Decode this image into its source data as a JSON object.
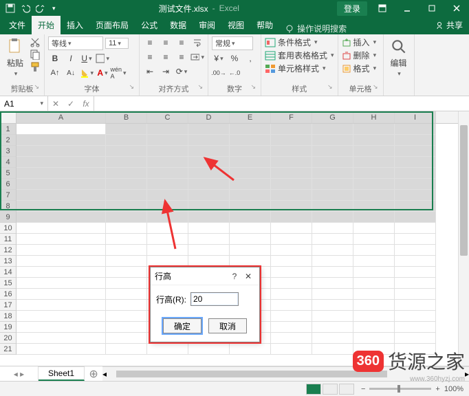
{
  "titlebar": {
    "filename": "测试文件.xlsx",
    "app": "Excel",
    "login": "登录"
  },
  "tabs": {
    "file": "文件",
    "home": "开始",
    "insert": "插入",
    "layout": "页面布局",
    "formulas": "公式",
    "data": "数据",
    "review": "审阅",
    "view": "视图",
    "help": "帮助",
    "tellme": "操作说明搜索",
    "share": "共享"
  },
  "ribbon": {
    "clipboard": {
      "paste": "粘贴",
      "label": "剪贴板"
    },
    "font": {
      "name": "等线",
      "size": "11",
      "label": "字体",
      "bold": "B",
      "italic": "I",
      "underline": "U"
    },
    "alignment": {
      "label": "对齐方式"
    },
    "number": {
      "format": "常规",
      "label": "数字"
    },
    "styles": {
      "cond": "条件格式",
      "tablefmt": "套用表格格式",
      "cellstyle": "单元格样式",
      "label": "样式"
    },
    "cells": {
      "insert": "插入",
      "delete": "删除",
      "format": "格式",
      "label": "单元格"
    },
    "editing": {
      "label": "编辑"
    }
  },
  "formulabar": {
    "namebox": "A1"
  },
  "columns": [
    "A",
    "B",
    "C",
    "D",
    "E",
    "F",
    "G",
    "H",
    "I"
  ],
  "rows": [
    "1",
    "2",
    "3",
    "4",
    "5",
    "6",
    "7",
    "8",
    "9",
    "10",
    "11",
    "12",
    "13",
    "14",
    "15",
    "16",
    "17",
    "18",
    "19",
    "20",
    "21"
  ],
  "selected_rows": [
    1,
    2,
    3,
    4,
    5,
    6,
    7,
    8,
    9
  ],
  "dialog": {
    "title": "行高",
    "label": "行高(R):",
    "value": "20",
    "ok": "确定",
    "cancel": "取消"
  },
  "sheet": {
    "name": "Sheet1"
  },
  "statusbar": {
    "zoom": "100%"
  },
  "watermark": {
    "logo": "360",
    "brand": "货源之家",
    "url": "www.360hyzj.com"
  }
}
